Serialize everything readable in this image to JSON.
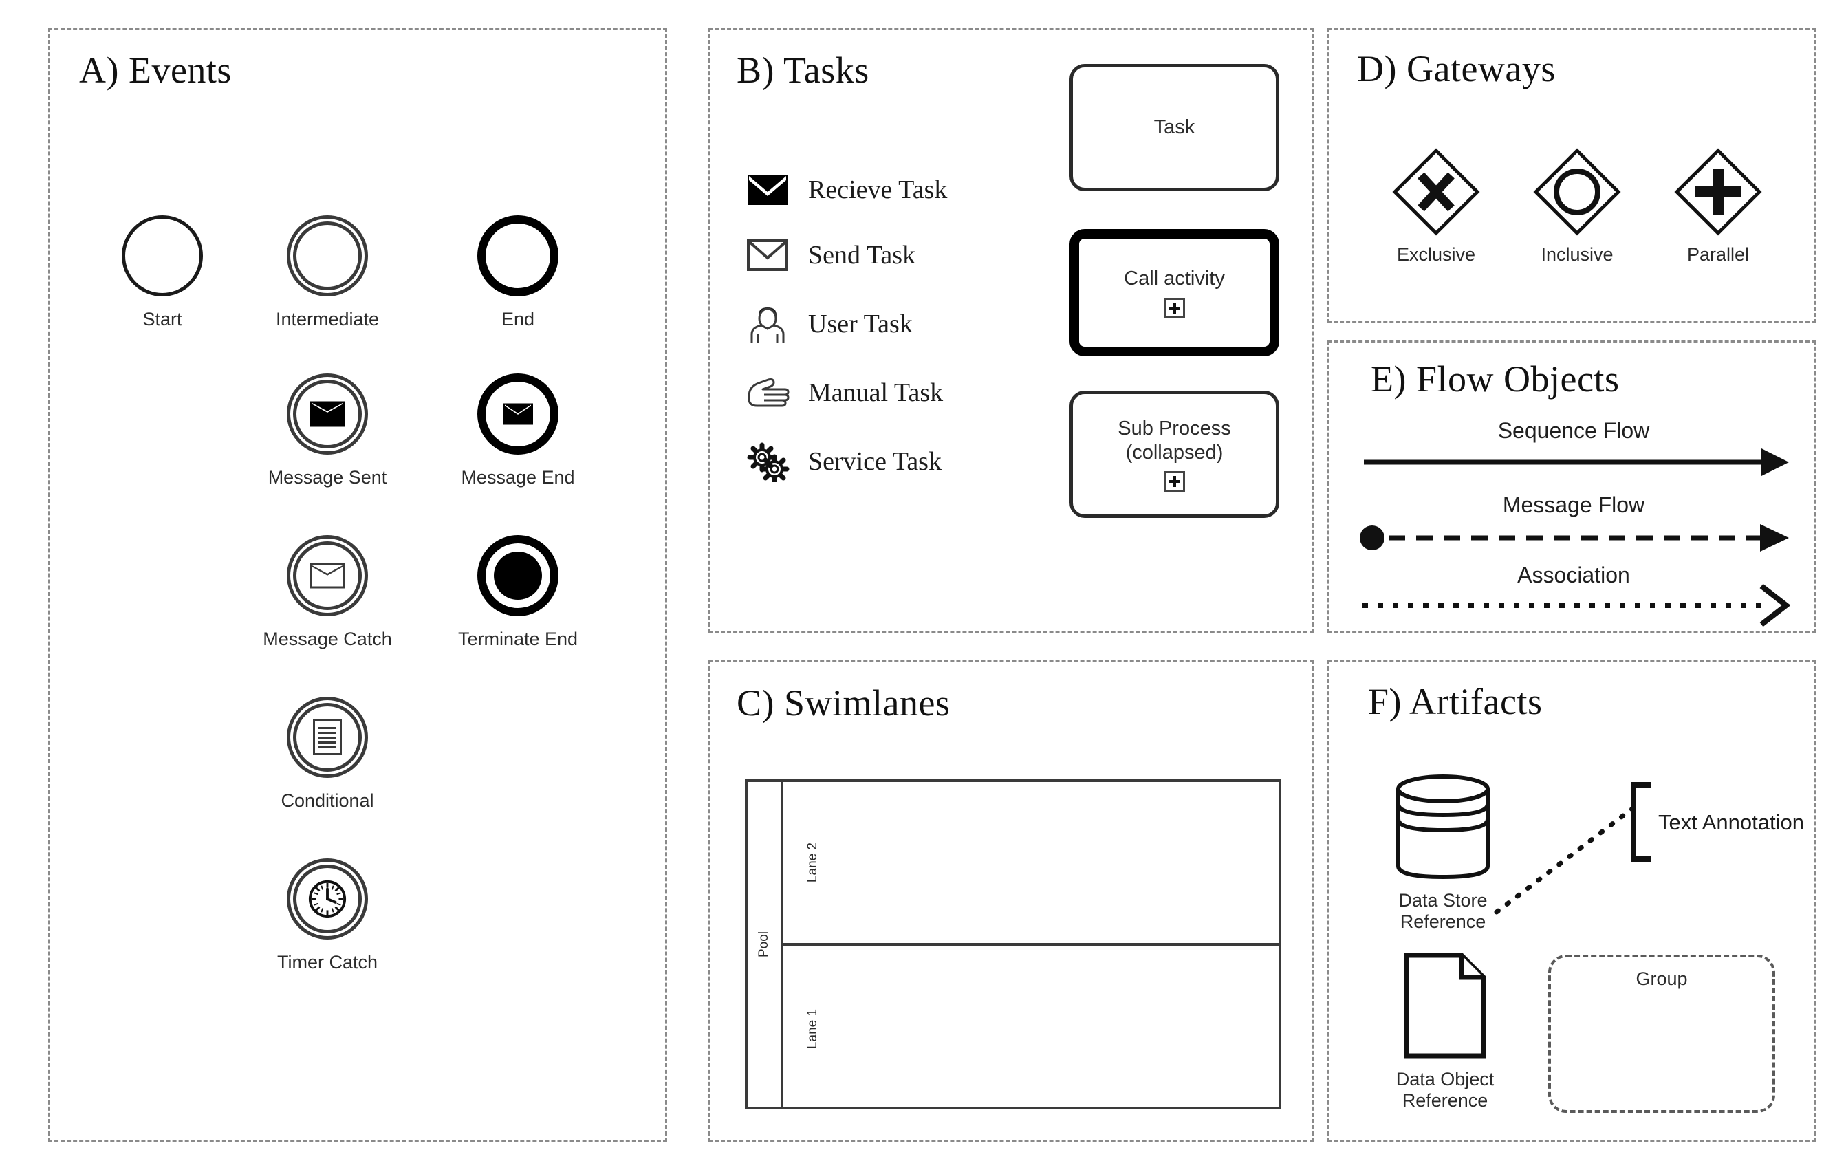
{
  "figure": {
    "description": "BPMN modelling notation legend with six lettered panels"
  },
  "panels": {
    "events": {
      "title": "A) Events",
      "items": [
        {
          "label": "Start",
          "icon": "start-event-circle-icon"
        },
        {
          "label": "Intermediate",
          "icon": "intermediate-event-double-circle-icon"
        },
        {
          "label": "End",
          "icon": "end-event-thick-circle-icon"
        },
        {
          "label": "Message Sent",
          "icon": "message-sent-event-icon"
        },
        {
          "label": "Message End",
          "icon": "message-end-event-icon"
        },
        {
          "label": "Message Catch",
          "icon": "message-catch-event-icon"
        },
        {
          "label": "Terminate End",
          "icon": "terminate-end-event-icon"
        },
        {
          "label": "Conditional",
          "icon": "conditional-event-icon"
        },
        {
          "label": "Timer Catch",
          "icon": "timer-catch-event-icon"
        }
      ]
    },
    "tasks": {
      "title": "B) Tasks",
      "types": [
        {
          "label": "Recieve Task",
          "icon": "envelope-filled-icon"
        },
        {
          "label": "Send Task",
          "icon": "envelope-outline-icon"
        },
        {
          "label": "User Task",
          "icon": "user-icon"
        },
        {
          "label": "Manual Task",
          "icon": "hand-icon"
        },
        {
          "label": "Service Task",
          "icon": "gears-icon"
        }
      ],
      "boxes": [
        {
          "label": "Task",
          "marker": "",
          "border": "thin"
        },
        {
          "label": "Call activity",
          "marker": "plus-box-marker-icon",
          "border": "thick"
        },
        {
          "label": "Sub Process\n(collapsed)",
          "label_line1": "Sub Process",
          "label_line2": "(collapsed)",
          "marker": "plus-box-marker-icon",
          "border": "thin"
        }
      ]
    },
    "swimlanes": {
      "title": "C) Swimlanes",
      "pool_label": "Pool",
      "lanes": [
        {
          "label": "Lane 2"
        },
        {
          "label": "Lane 1"
        }
      ]
    },
    "gateways": {
      "title": "D) Gateways",
      "items": [
        {
          "label": "Exclusive",
          "icon": "gateway-exclusive-x-icon"
        },
        {
          "label": "Inclusive",
          "icon": "gateway-inclusive-circle-icon"
        },
        {
          "label": "Parallel",
          "icon": "gateway-parallel-plus-icon"
        }
      ]
    },
    "flow_objects": {
      "title": "E) Flow Objects",
      "items": [
        {
          "label": "Sequence Flow",
          "icon": "solid-arrow-icon"
        },
        {
          "label": "Message Flow",
          "icon": "dashed-arrow-with-start-circle-icon"
        },
        {
          "label": "Association",
          "icon": "dotted-open-arrow-icon"
        }
      ]
    },
    "artifacts": {
      "title": "F) Artifacts",
      "items": [
        {
          "label_line1": "Data Store",
          "label_line2": "Reference",
          "icon": "data-store-cylinder-icon"
        },
        {
          "label_line1": "Data Object",
          "label_line2": "Reference",
          "icon": "data-object-page-icon"
        }
      ],
      "text_annotation": "Text Annotation",
      "group": "Group"
    }
  },
  "colors": {
    "stroke": "#1a1a1a",
    "stroke_light": "#3a3a3a",
    "panel_border": "#8a8a8a",
    "label": "#2b2b2b",
    "background": "#ffffff"
  }
}
